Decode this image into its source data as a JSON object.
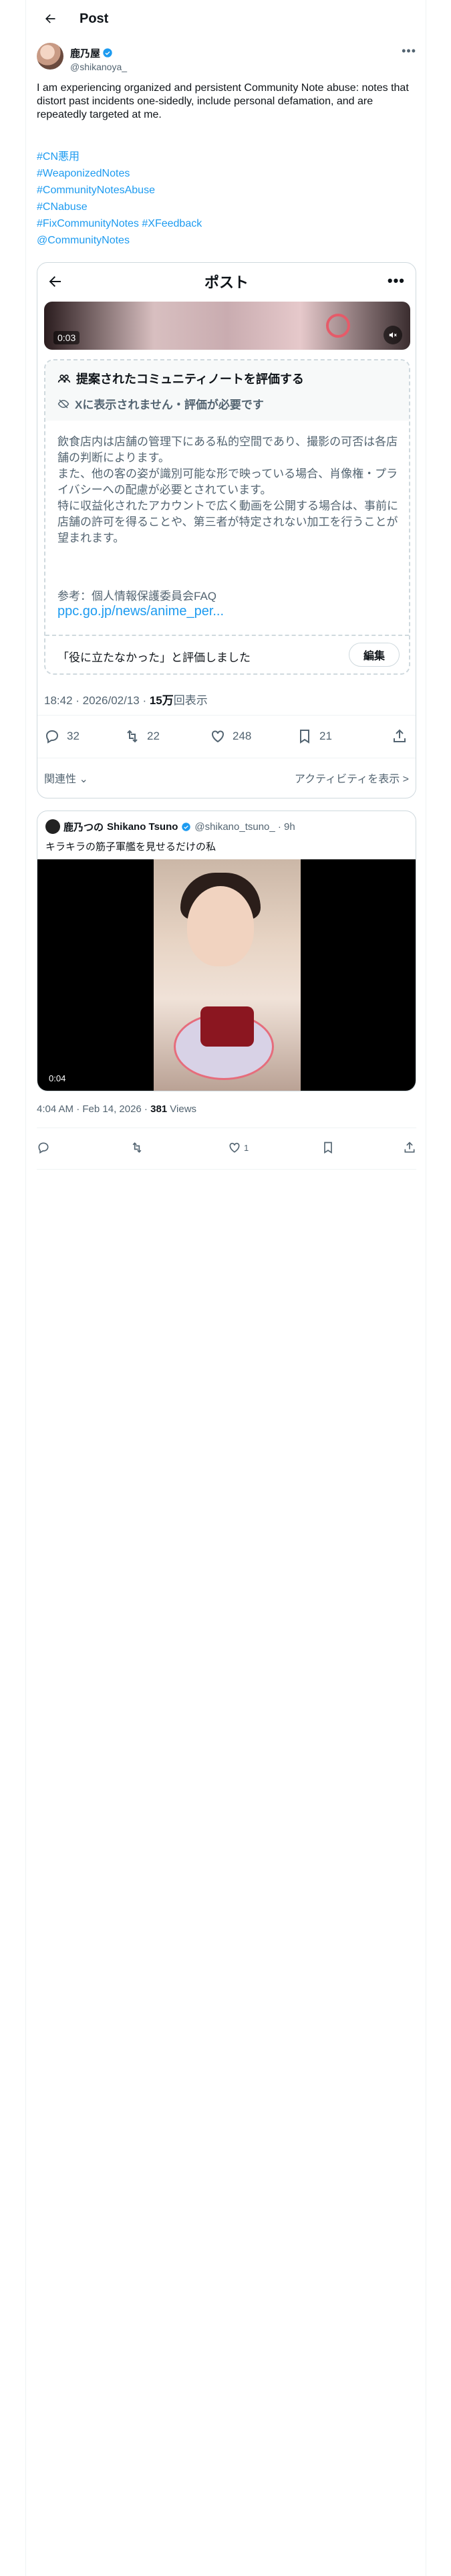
{
  "header": {
    "title": "Post"
  },
  "author": {
    "display_name": "鹿乃屋",
    "handle": "@shikanoya_"
  },
  "post": {
    "text": "I am experiencing organized and persistent Community Note abuse: notes that distort past incidents one-sidedly, include personal defamation, and are repeatedly targeted at me.",
    "hashtags": [
      "#CN悪用",
      "#WeaponizedNotes",
      "#CommunityNotesAbuse",
      "#CNabuse",
      "#FixCommunityNotes #XFeedback",
      "@CommunityNotes"
    ]
  },
  "screenshot": {
    "title": "ポスト",
    "video_time": "0:03",
    "note": {
      "heading": "提案されたコミュニティノートを評価する",
      "status": "Xに表示されません・評価が必要です",
      "body": "飲食店内は店舗の管理下にある私的空間であり、撮影の可否は各店舗の判断によります。\nまた、他の客の姿が識別可能な形で映っている場合、肖像権・プライバシーへの配慮が必要とされています。\n特に収益化されたアカウントで広く動画を公開する場合は、事前に店舗の許可を得ることや、第三者が特定されない加工を行うことが望まれます。",
      "reference_label": "参考：個人情報保護委員会FAQ",
      "reference_link": "ppc.go.jp/news/anime_per...",
      "rated": "「役に立たなかった」と評価しました",
      "edit_label": "編集"
    },
    "meta_time": "18:42 · 2026/02/13 · ",
    "meta_views": "15万",
    "meta_views_suffix": "回表示",
    "actions": {
      "replies": "32",
      "reposts": "22",
      "likes": "248",
      "bookmarks": "21"
    },
    "relevance": "関連性",
    "activity": "アクティビティを表示 >"
  },
  "quote": {
    "display_name": "鹿乃つの",
    "display_name_en": "Shikano Tsuno",
    "handle_time": "@shikano_tsuno_ · 9h",
    "text": "キラキラの筋子軍艦を見せるだけの私",
    "video_time": "0:04"
  },
  "meta": {
    "time": "4:04 AM · Feb 14, 2026 · ",
    "views": "381",
    "views_label": " Views"
  },
  "actions": {
    "likes": "1"
  },
  "colors": {
    "accent": "#1d9bf0",
    "text": "#0f1419",
    "muted": "#536471",
    "border": "#cfd9de"
  }
}
